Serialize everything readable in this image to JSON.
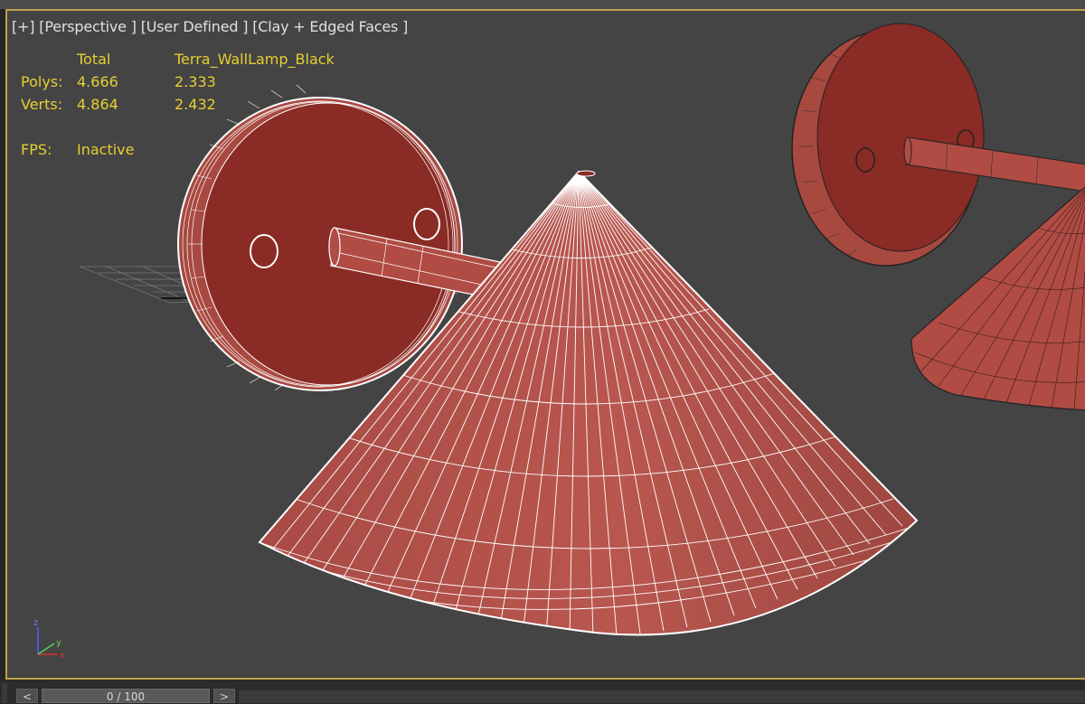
{
  "viewport": {
    "labels": [
      "[+]",
      "[Perspective ]",
      "[User Defined ]",
      "[Clay + Edged Faces ]"
    ]
  },
  "stats": {
    "col_total": "Total",
    "col_object": "Terra_WallLamp_Black",
    "polys_label": "Polys:",
    "polys_total": "4.666",
    "polys_object": "2.333",
    "verts_label": "Verts:",
    "verts_total": "4.864",
    "verts_object": "2.432",
    "fps_label": "FPS:",
    "fps_value": "Inactive"
  },
  "gizmo": {
    "z": "z",
    "x": "x",
    "y": "y"
  },
  "timeline": {
    "prev": "<",
    "frame": "0 / 100",
    "next": ">"
  },
  "colors": {
    "viewport_bg": "#444444",
    "active_border": "#bfa24a",
    "stats_text": "#e7cf32",
    "clay": "#b5524a",
    "wire": "#ffffff"
  }
}
